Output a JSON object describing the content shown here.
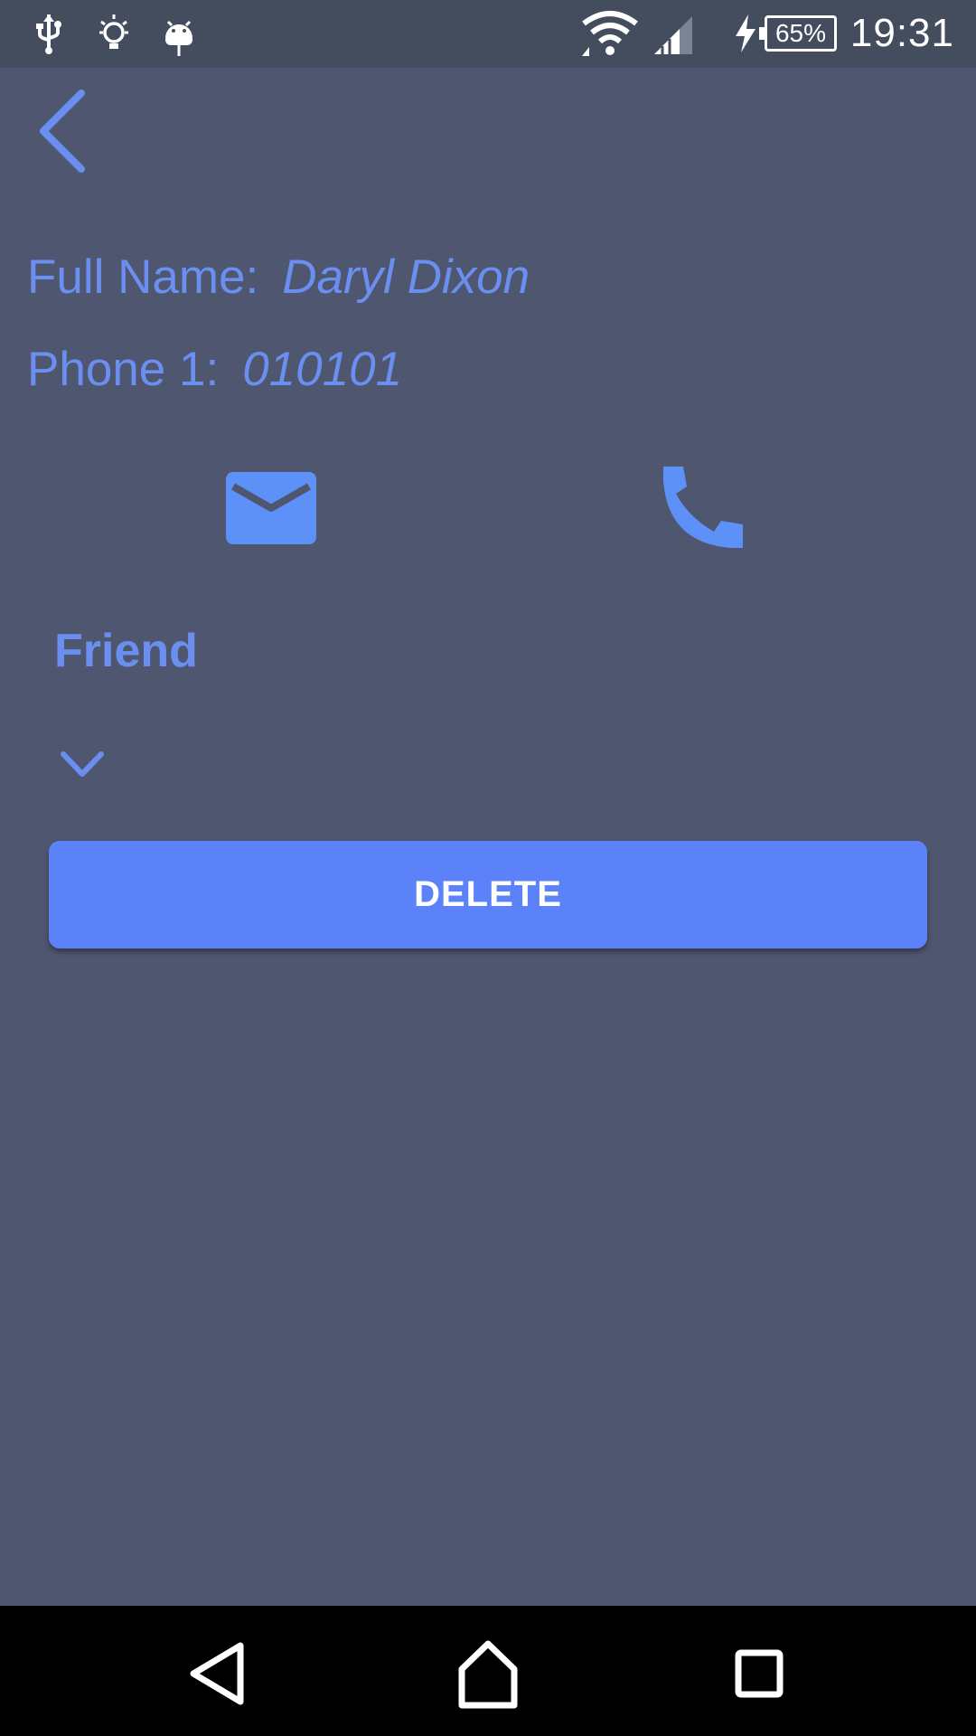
{
  "status_bar": {
    "time": "19:31",
    "battery_percent": "65%",
    "left_icons": [
      "usb-icon",
      "lightbulb-icon",
      "android-debug-icon"
    ],
    "right_icons": [
      "wifi-icon",
      "cell-signal-icon",
      "charging-icon"
    ]
  },
  "contact": {
    "full_name_label": "Full Name:",
    "full_name_value": "Daryl Dixon",
    "phone_label": "Phone 1:",
    "phone_value": "010101"
  },
  "actions": {
    "email_icon": "mail-icon",
    "call_icon": "phone-icon"
  },
  "group": {
    "label": "Friend",
    "dropdown_icon": "chevron-down-icon"
  },
  "delete_button_label": "DELETE",
  "nav_bar": {
    "icons": [
      "nav-back-icon",
      "nav-home-icon",
      "nav-recents-icon"
    ]
  },
  "colors": {
    "background": "#4f5670",
    "status_bar": "#434d5e",
    "accent": "#5b82f8",
    "text_accent": "#6b8ff0",
    "nav_bar": "#000000"
  }
}
